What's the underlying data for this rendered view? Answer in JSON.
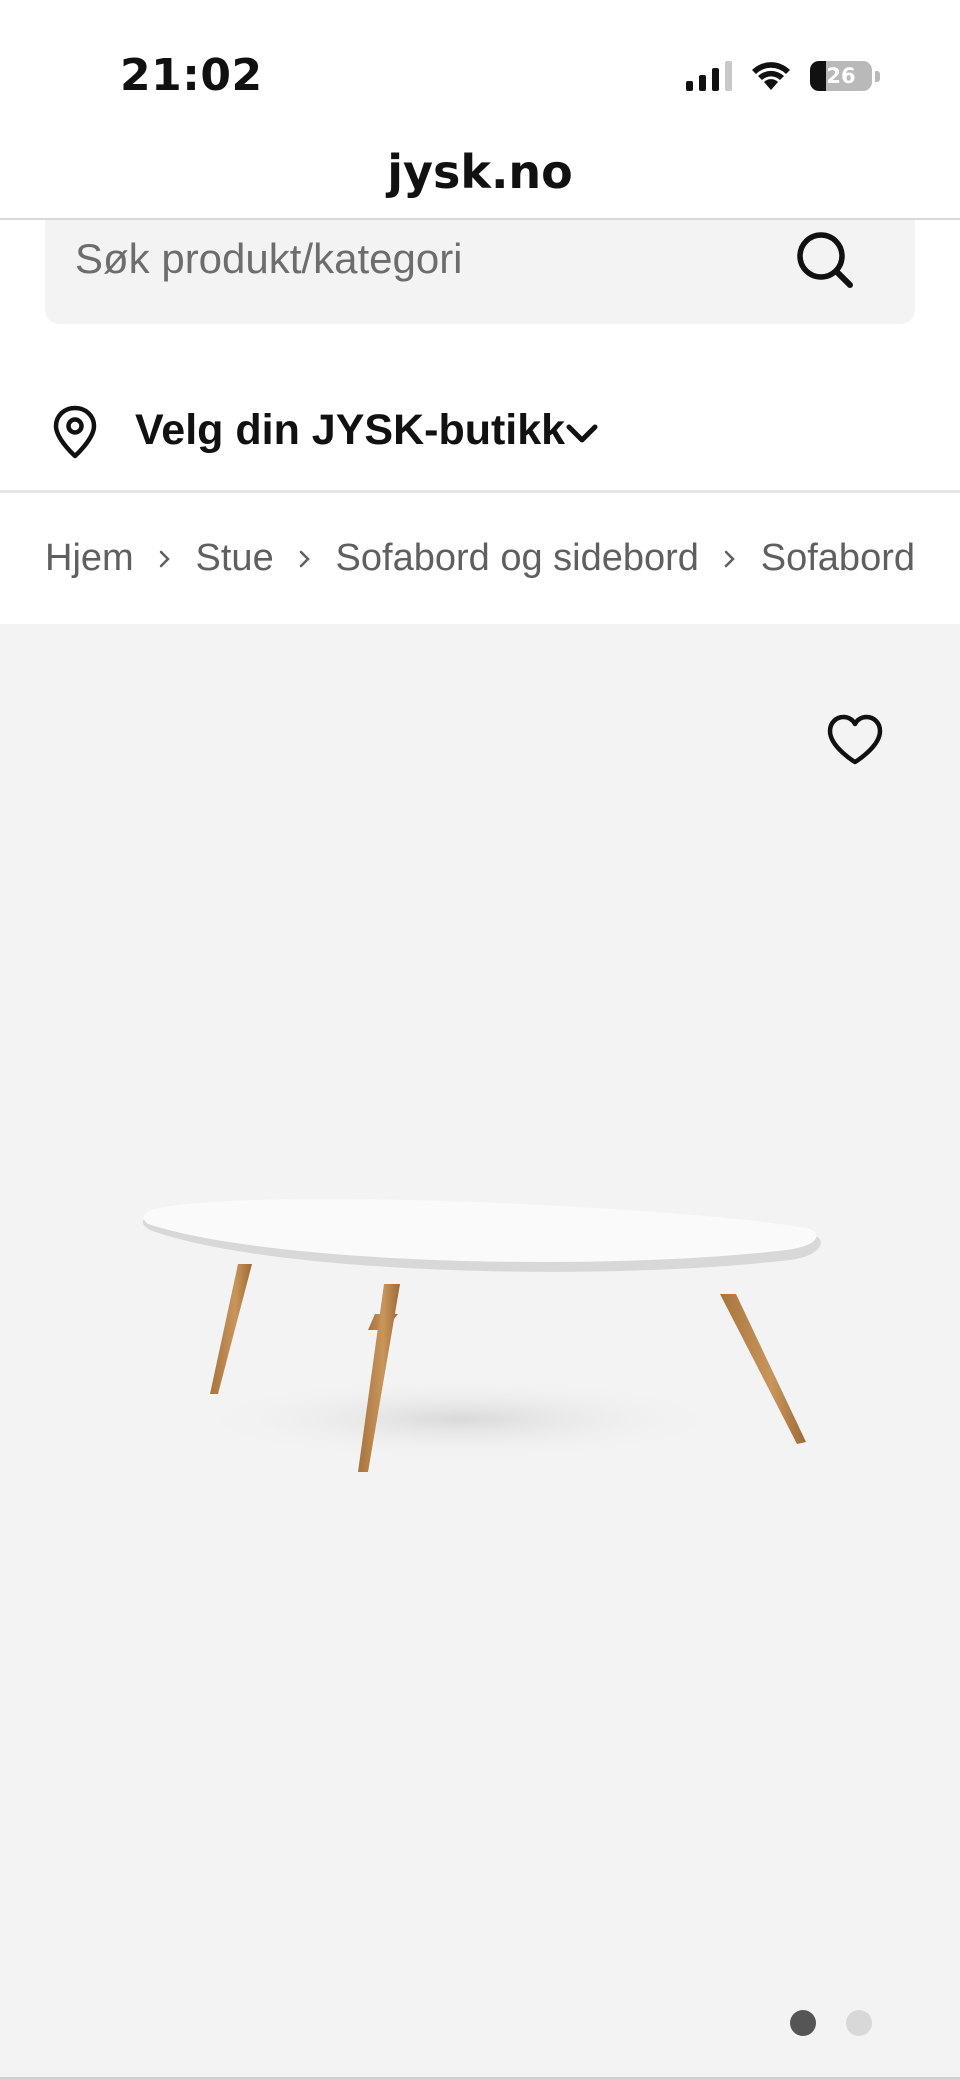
{
  "status_bar": {
    "time": "21:02",
    "battery_level": "26",
    "icons": [
      "cellular-signal-icon",
      "wifi-icon",
      "battery-icon"
    ]
  },
  "browser": {
    "url": "jysk.no"
  },
  "search": {
    "placeholder": "Søk produkt/kategori",
    "value": "",
    "icon": "search-icon"
  },
  "store_selector": {
    "label": "Velg din JYSK-butikk",
    "icon": "location-pin-icon",
    "chevron": "chevron-down-icon"
  },
  "breadcrumb": {
    "items": [
      {
        "label": "Hjem"
      },
      {
        "label": "Stue"
      },
      {
        "label": "Sofabord og sidebord"
      },
      {
        "label": "Sofabord"
      }
    ],
    "separator_icon": "chevron-right-icon"
  },
  "gallery": {
    "favorite_icon": "heart-outline-icon",
    "image_description_icon": "coffee-table-product-image",
    "total_images": 2,
    "active_index": 0
  },
  "colors": {
    "gallery_background": "#f3f3f3",
    "text_primary": "#111111",
    "text_muted": "#5f5f5f",
    "dot_active": "#555555",
    "dot_inactive": "#d8d8d8"
  }
}
